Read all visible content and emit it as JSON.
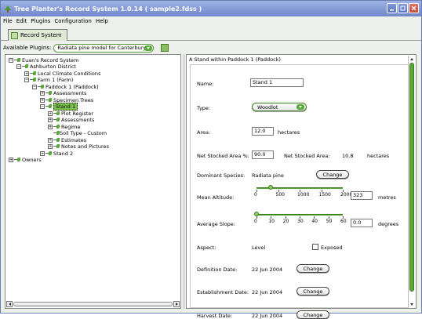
{
  "window": {
    "title": "Tree Planter's Record System 1.0.14 ( sample2.fdss )"
  },
  "menu": [
    "File",
    "Edit",
    "Plugins",
    "Configuration",
    "Help"
  ],
  "tab": {
    "label": "Record System"
  },
  "plugins": {
    "label": "Available Plugins:",
    "selected": "Radiata pine model for Canterbury"
  },
  "tree": [
    {
      "label": "Euan's Record System",
      "toggle": "⊟"
    },
    {
      "label": "Ashburton District",
      "toggle": "⊟"
    },
    {
      "label": "Local Climate Conditions",
      "toggle": "⊞"
    },
    {
      "label": "Farm 1 (Farm)",
      "toggle": "⊟"
    },
    {
      "label": "Paddock 1 (Paddock)",
      "toggle": "⊟"
    },
    {
      "label": "Assessments",
      "toggle": "⊞"
    },
    {
      "label": "Specimen Trees",
      "toggle": "⊞"
    },
    {
      "label": "Stand 1",
      "toggle": "⊟"
    },
    {
      "label": "Plot Register",
      "toggle": "⊞"
    },
    {
      "label": "Assessments",
      "toggle": "⊞"
    },
    {
      "label": "Regime",
      "toggle": "⊞"
    },
    {
      "label": "Soil Type - Custom",
      "toggle": ""
    },
    {
      "label": "Estimates",
      "toggle": "⊞"
    },
    {
      "label": "Notes and Pictures",
      "toggle": "⊞"
    },
    {
      "label": "Stand 2",
      "toggle": "⊞"
    },
    {
      "label": "Owners",
      "toggle": "⊞"
    }
  ],
  "detail": {
    "header": "A Stand within Paddock 1 (Paddock)",
    "name": {
      "label": "Name:",
      "value": "Stand 1"
    },
    "type": {
      "label": "Type:",
      "value": "Woodlot"
    },
    "area": {
      "label": "Area:",
      "value": "12.0",
      "unit": "hectares"
    },
    "net": {
      "label": "Net Stocked Area %:",
      "value": "90.0",
      "label2": "Net Stocked Area:",
      "value2": "10.8",
      "unit": "hectares"
    },
    "species": {
      "label": "Dominant Species:",
      "value": "Radiata pine",
      "button": "Change"
    },
    "altitude": {
      "label": "Mean Altitude:",
      "ticks": [
        "0",
        "500",
        "1000",
        "1500",
        "2000"
      ],
      "value": "323",
      "unit": "metres",
      "level": 0.16
    },
    "slope": {
      "label": "Average Slope:",
      "ticks": [
        "0",
        "10",
        "20",
        "30",
        "40",
        "50",
        "60"
      ],
      "value": "0.0",
      "unit": "degrees",
      "level": 0
    },
    "aspect": {
      "label": "Aspect:",
      "value": "Level",
      "checkbox": "Exposed"
    },
    "definition": {
      "label": "Definition Date:",
      "value": "22 Jun 2004",
      "button": "Change"
    },
    "establishment": {
      "label": "Establishment Date:",
      "value": "22 Jun 2004",
      "button": "Change"
    },
    "harvest": {
      "label": "Harvest Date:",
      "value": "22 Jun 2004",
      "button": "Change"
    }
  },
  "colors": {
    "accent": "#5aa83a",
    "titlebar": "#7a90d0",
    "selection": "#7ec24e"
  }
}
